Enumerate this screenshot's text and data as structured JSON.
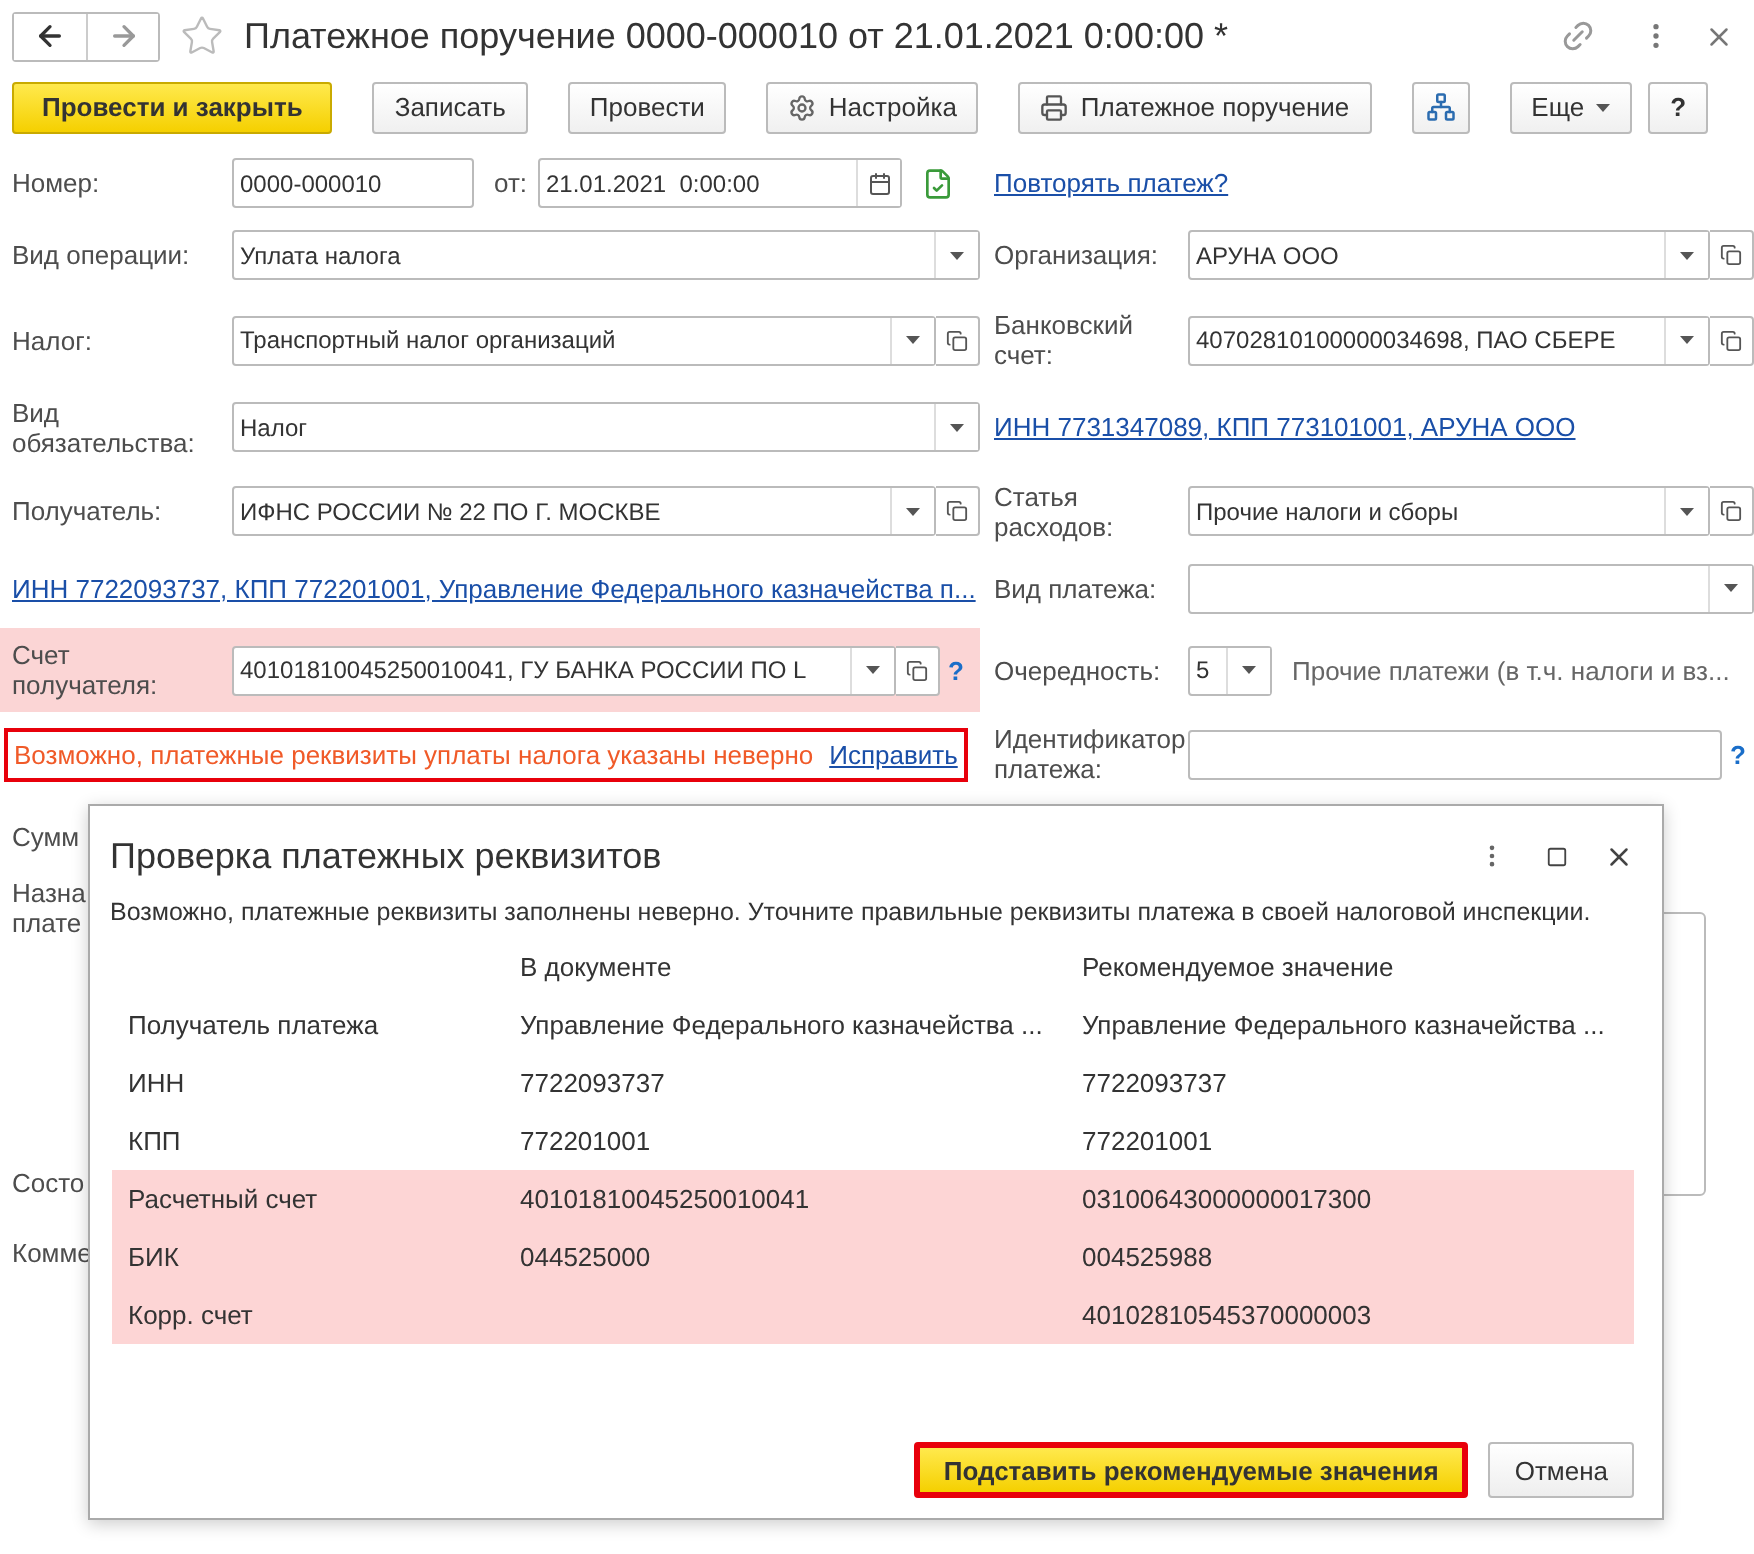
{
  "window": {
    "title": "Платежное поручение 0000-000010 от 21.01.2021 0:00:00 *"
  },
  "toolbar": [
    {
      "kind": "primary",
      "label": "Провести и закрыть"
    },
    {
      "kind": "plain",
      "label": "Записать"
    },
    {
      "kind": "plain",
      "label": "Провести"
    },
    {
      "kind": "settings",
      "label": "Настройка"
    },
    {
      "kind": "print",
      "label": "Платежное поручение"
    },
    {
      "kind": "structure"
    },
    {
      "kind": "menu",
      "label": "Еще"
    },
    {
      "kind": "help",
      "label": "?"
    }
  ],
  "rows": [
    {
      "left": {
        "kind": "number_date",
        "label": "Номер:",
        "value": "0000-000010",
        "date_label": "от:",
        "date": "21.01.2021  0:00:00"
      },
      "right": {
        "kind": "link",
        "text": "Повторять платеж?"
      }
    },
    {
      "left": {
        "kind": "field",
        "label": "Вид операции:",
        "value": "Уплата налога",
        "dropdown": true
      },
      "right": {
        "kind": "field",
        "label": "Организация:",
        "value": "АРУНА ООО",
        "dropdown": true,
        "open": true
      }
    },
    {
      "left": {
        "kind": "field",
        "label": "Налог:",
        "value": "Транспортный налог организаций",
        "dropdown": true,
        "open": true
      },
      "right": {
        "kind": "field",
        "label": "Банковский счет:",
        "value": "40702810100000034698, ПАО СБЕРЕ",
        "dropdown": true,
        "open": true
      }
    },
    {
      "left": {
        "kind": "field",
        "label": "Вид обязательства:",
        "value": "Налог",
        "dropdown": true
      },
      "right": {
        "kind": "link",
        "text": "ИНН 7731347089, КПП 773101001, АРУНА ООО"
      }
    },
    {
      "left": {
        "kind": "field",
        "label": "Получатель:",
        "value": "ИФНС РОССИИ № 22 ПО Г. МОСКВЕ",
        "dropdown": true,
        "open": true
      },
      "right": {
        "kind": "field",
        "label": "Статья расходов:",
        "value": "Прочие налоги и сборы",
        "dropdown": true,
        "open": true
      }
    },
    {
      "left": {
        "kind": "link",
        "text": "ИНН 7722093737, КПП 772201001, Управление Федерального казначейства п..."
      },
      "right": {
        "kind": "field",
        "label": "Вид платежа:",
        "dropdown": true
      }
    },
    {
      "left": {
        "kind": "field",
        "label": "Счет получателя:",
        "value": "40101810045250010041, ГУ БАНКА РОССИИ ПО L",
        "dropdown": true,
        "open": true,
        "help": "?",
        "highlighted": true
      },
      "right": {
        "kind": "priority",
        "label": "Очередность:",
        "value": "5",
        "note": "Прочие платежи (в т.ч. налоги и вз..."
      }
    },
    {
      "left": {
        "kind": "error",
        "text": "Возможно, платежные реквизиты уплаты налога указаны неверно",
        "action": "Исправить",
        "outlined": true
      },
      "right": {
        "kind": "field",
        "label": "Идентификатор платежа:",
        "help": "?"
      }
    }
  ],
  "lower_labels": [
    "Сумм",
    "Назна",
    "плате",
    "Состо",
    "Комме"
  ],
  "dialog": {
    "title": "Проверка платежных реквизитов",
    "message": "Возможно, платежные реквизиты заполнены неверно. Уточните правильные реквизиты платежа в своей налоговой инспекции.",
    "columns": [
      "В документе",
      "Рекомендуемое значение"
    ],
    "rows": [
      {
        "label": "Получатель платежа",
        "document": "Управление Федерального казначейства ...",
        "recommended": "Управление Федерального казначейства ...",
        "mismatch": false
      },
      {
        "label": "ИНН",
        "document": "7722093737",
        "recommended": "7722093737",
        "mismatch": false
      },
      {
        "label": "КПП",
        "document": "772201001",
        "recommended": "772201001",
        "mismatch": false
      },
      {
        "label": "Расчетный счет",
        "document": "40101810045250010041",
        "recommended": "03100643000000017300",
        "mismatch": true
      },
      {
        "label": "БИК",
        "document": "044525000",
        "recommended": "004525988",
        "mismatch": true
      },
      {
        "label": "Корр. счет",
        "recommended": "40102810545370000003",
        "mismatch": true
      }
    ],
    "buttons": [
      {
        "kind": "primary",
        "label": "Подставить рекомендуемые значения",
        "outlined": true
      },
      {
        "kind": "plain",
        "label": "Отмена",
        "outlined": false
      }
    ]
  }
}
